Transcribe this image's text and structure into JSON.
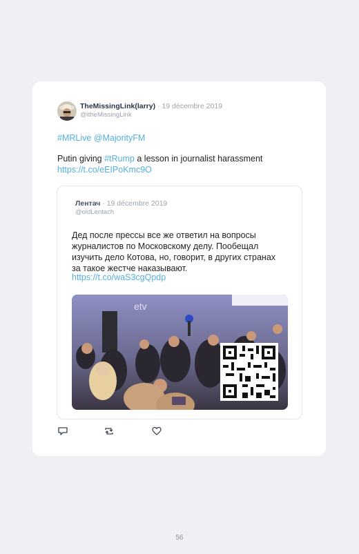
{
  "tweet": {
    "author_name": "TheMissingLink(larry)",
    "date": " · 19 décembre 2019",
    "handle": "@itheMissingLink",
    "tag_mrlive": "#MRLive",
    "tag_majority": "@MajorityFM",
    "text_before": "Putin giving ",
    "tag_trump": "#tRump",
    "text_after": " a lesson in journalist harassment",
    "link": "https://t.co/eEIPoKmc9O"
  },
  "quoted": {
    "author_name": "Лентач",
    "date": " · 19 décembre 2019",
    "handle": "@oldLentach",
    "text": "Дед после прессы все же ответил на вопросы журналистов по Московскому делу. Пообещал изучить дело Котова, но, говорит, в других странах за такое жестче наказывают.",
    "link": "https://t.co/waS3cgQpdp",
    "photo_sign": "etv"
  },
  "actions": {
    "reply_icon": "reply-icon",
    "retweet_icon": "retweet-icon",
    "like_icon": "heart-icon"
  },
  "page_number": "56",
  "colors": {
    "background": "#eef0f6",
    "card": "#ffffff",
    "link": "#52b0e0",
    "muted": "#9aa3ad"
  }
}
